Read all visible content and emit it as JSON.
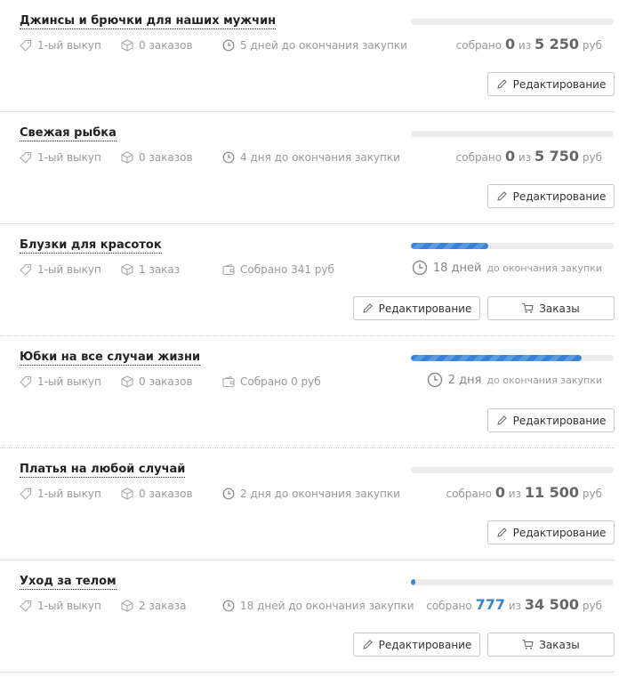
{
  "collected_label": "собрано",
  "of_label": "из",
  "currency": "руб",
  "edit_label": "Редактирование",
  "orders_label": "Заказы",
  "accent_color": "#3a82d6",
  "items": [
    {
      "title": "Джинсы и брючки для наших мужчин",
      "issue": "1-ый выкуп",
      "orders": "0 заказов",
      "info": "5 дней до окончания закупки",
      "progress": 0,
      "collected": "0",
      "target": "5 250"
    },
    {
      "title": "Свежая рыбка",
      "issue": "1-ый выкуп",
      "orders": "0 заказов",
      "info": "4 дня до окончания закупки",
      "progress": 0,
      "collected": "0",
      "target": "5 750"
    },
    {
      "title": "Блузки для красоток",
      "issue": "1-ый выкуп",
      "orders": "1 заказ",
      "info": "Собрано 341 руб",
      "progress": 0.38,
      "deadline_big": "18 дней",
      "deadline_small": "до окончания закупки"
    },
    {
      "title": "Юбки на все случаи жизни",
      "issue": "1-ый выкуп",
      "orders": "0 заказов",
      "info": "Собрано 0 руб",
      "progress": 0.84,
      "deadline_big": "2 дня",
      "deadline_small": "до окончания закупки"
    },
    {
      "title": "Платья на любой случай",
      "issue": "1-ый выкуп",
      "orders": "0 заказов",
      "info": "2 дня до окончания закупки",
      "progress": 0,
      "collected": "0",
      "target": "11 500"
    },
    {
      "title": "Уход за телом",
      "issue": "1-ый выкуп",
      "orders": "2 заказа",
      "info": "18 дней до окончания закупки",
      "progress": 0.02,
      "collected": "777",
      "target": "34 500"
    }
  ]
}
